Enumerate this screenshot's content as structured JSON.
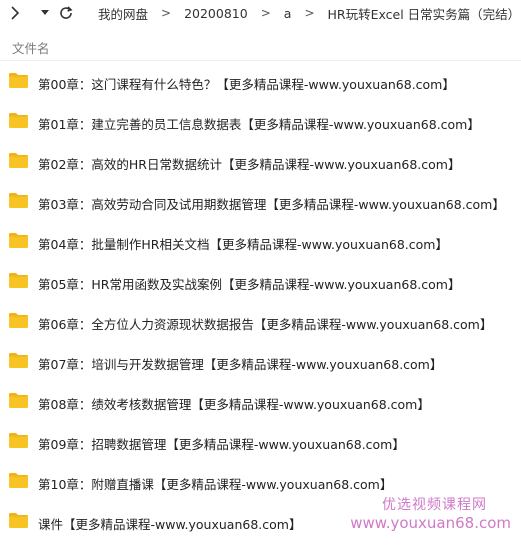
{
  "toolbar": {
    "icons": [
      "chevron-right-icon",
      "caret-down-icon",
      "refresh-icon"
    ],
    "breadcrumbs": [
      "我的网盘",
      "20200810",
      "a",
      "HR玩转Excel 日常实务篇（完结）"
    ],
    "separator": ">"
  },
  "list_header": {
    "name_label": "文件名"
  },
  "files": [
    {
      "name": "第00章：这门课程有什么特色？【更多精品课程-www.youxuan68.com】",
      "icon": "folder-icon"
    },
    {
      "name": "第01章：建立完善的员工信息数据表【更多精品课程-www.youxuan68.com】",
      "icon": "folder-icon"
    },
    {
      "name": "第02章：高效的HR日常数据统计【更多精品课程-www.youxuan68.com】",
      "icon": "folder-icon"
    },
    {
      "name": "第03章：高效劳动合同及试用期数据管理【更多精品课程-www.youxuan68.com】",
      "icon": "folder-icon"
    },
    {
      "name": "第04章：批量制作HR相关文档【更多精品课程-www.youxuan68.com】",
      "icon": "folder-icon"
    },
    {
      "name": "第05章：HR常用函数及实战案例【更多精品课程-www.youxuan68.com】",
      "icon": "folder-icon"
    },
    {
      "name": "第06章：全方位人力资源现状数据报告【更多精品课程-www.youxuan68.com】",
      "icon": "folder-icon"
    },
    {
      "name": "第07章：培训与开发数据管理【更多精品课程-www.youxuan68.com】",
      "icon": "folder-icon"
    },
    {
      "name": "第08章：绩效考核数据管理【更多精品课程-www.youxuan68.com】",
      "icon": "folder-icon"
    },
    {
      "name": "第09章：招聘数据管理【更多精品课程-www.youxuan68.com】",
      "icon": "folder-icon"
    },
    {
      "name": "第10章：附赠直播课【更多精品课程-www.youxuan68.com】",
      "icon": "folder-icon"
    },
    {
      "name": "课件【更多精品课程-www.youxuan68.com】",
      "icon": "folder-icon"
    }
  ],
  "watermark": {
    "line1": "优选视频课程网",
    "line2": "www.youxuan68.com"
  },
  "colors": {
    "folder": "#f7c325",
    "folder_tab": "#f2b31a",
    "watermark": "#d079c8",
    "header_text": "#7a7a7a"
  }
}
